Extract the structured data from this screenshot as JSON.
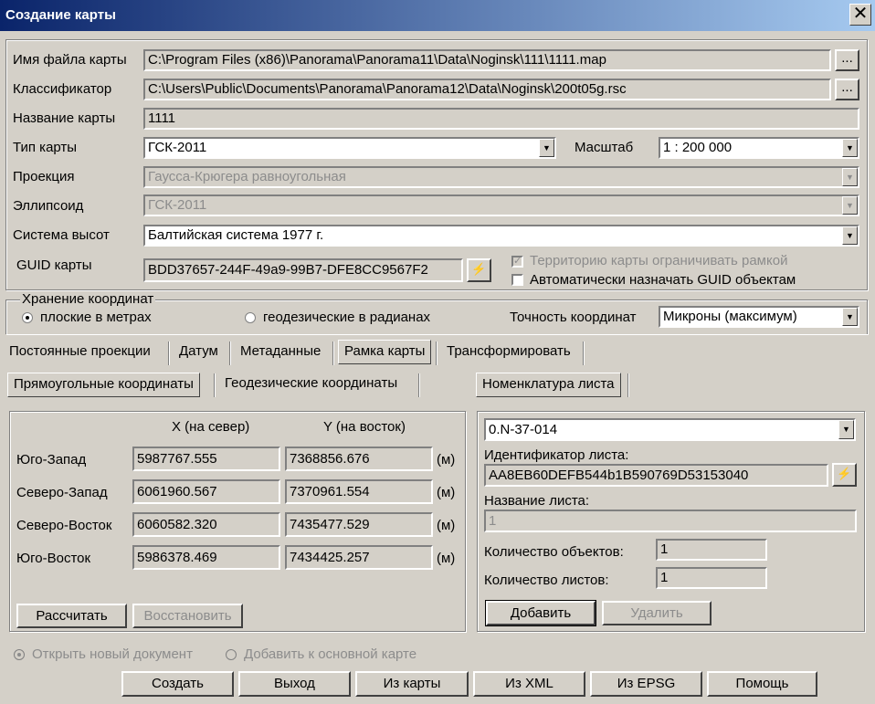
{
  "window": {
    "title": "Создание карты",
    "close": "✕"
  },
  "form": {
    "filename_label": "Имя файла карты",
    "filename_value": "C:\\Program Files (x86)\\Panorama\\Panorama11\\Data\\Noginsk\\111\\1111.map",
    "browse": "...",
    "classifier_label": "Классификатор",
    "classifier_value": "C:\\Users\\Public\\Documents\\Panorama\\Panorama12\\Data\\Noginsk\\200t05g.rsc",
    "mapname_label": "Название карты",
    "mapname_value": "1111",
    "maptype_label": "Тип карты",
    "maptype_value": "ГСК-2011",
    "scale_label": "Масштаб",
    "scale_value": "1 : 200 000",
    "projection_label": "Проекция",
    "projection_value": "Гаусса-Крюгера равноугольная",
    "ellipsoid_label": "Эллипсоид",
    "ellipsoid_value": "ГСК-2011",
    "heights_label": "Система высот",
    "heights_value": "Балтийская система 1977 г.",
    "guid_label": "GUID карты",
    "guid_value": "BDD37657-244F-49a9-99B7-DFE8CC9567F2",
    "gen_icon": "⚡",
    "limit_frame_label": "Территорию карты ограничивать рамкой",
    "auto_guid_label": "Автоматически назначать GUID объектам"
  },
  "coords": {
    "group_title": "Хранение координат",
    "radio_meters": "плоские в метрах",
    "radio_radians": "геодезические в радианах",
    "precision_label": "Точность координат",
    "precision_value": "Микроны (максимум)"
  },
  "tabs": [
    "Постоянные проекции",
    "Датум",
    "Метаданные",
    "Рамка карты",
    "Трансформировать"
  ],
  "subtabs": [
    "Прямоугольные координаты",
    "Геодезические координаты"
  ],
  "nomenclature_tab": "Номенклатура листа",
  "frame": {
    "col_x": "X (на север)",
    "col_y": "Y (на восток)",
    "unit": "(м)",
    "rows": [
      {
        "label": "Юго-Запад",
        "x": "5987767.555",
        "y": "7368856.676"
      },
      {
        "label": "Северо-Запад",
        "x": "6061960.567",
        "y": "7370961.554"
      },
      {
        "label": "Северо-Восток",
        "x": "6060582.320",
        "y": "7435477.529"
      },
      {
        "label": "Юго-Восток",
        "x": "5986378.469",
        "y": "7434425.257"
      }
    ],
    "calc_button": "Рассчитать",
    "restore_button": "Восстановить"
  },
  "sheet": {
    "nomenclature_value": "0.N-37-014",
    "id_label": "Идентификатор листа:",
    "id_value": "AA8EB60DEFB544b1B590769D53153040",
    "name_label": "Название листа:",
    "name_value": "1",
    "objects_label": "Количество объектов:",
    "objects_value": "1",
    "sheets_label": "Количество листов:",
    "sheets_value": "1",
    "add_button": "Добавить",
    "delete_button": "Удалить"
  },
  "bottom": {
    "radio_new": "Открыть новый документ",
    "radio_add": "Добавить к основной карте",
    "buttons": [
      "Создать",
      "Выход",
      "Из карты",
      "Из XML",
      "Из EPSG",
      "Помощь"
    ]
  }
}
